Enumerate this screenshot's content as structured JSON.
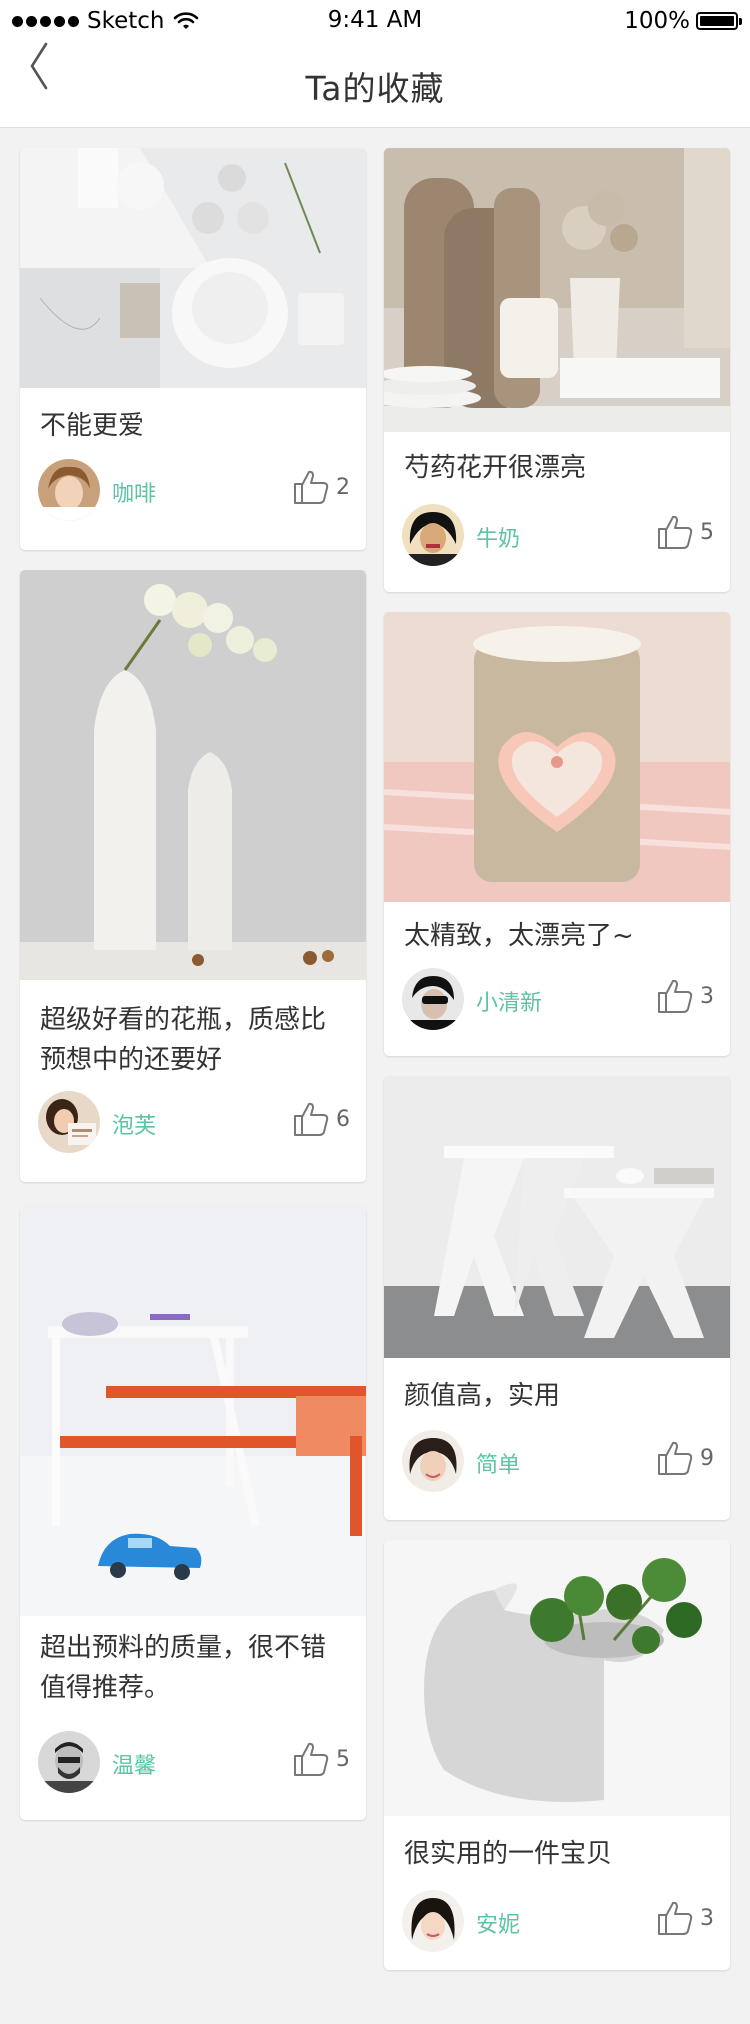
{
  "status_bar": {
    "carrier": "Sketch",
    "time": "9:41 AM",
    "battery": "100%"
  },
  "nav": {
    "title": "Ta的收藏",
    "back_icon": "chevron-left-icon"
  },
  "colors": {
    "username": "#5cc3a4",
    "background": "#f2f2f2",
    "card": "#ffffff"
  },
  "cards": [
    {
      "text": "不能更爱",
      "user": "咖啡",
      "likes": "2"
    },
    {
      "text": "超级好看的花瓶，质感比预想中的还要好",
      "user": "泡芙",
      "likes": "6"
    },
    {
      "text": "超出预料的质量，很不错值得推荐。",
      "user": "温馨",
      "likes": "5"
    },
    {
      "text": "芍药花开很漂亮",
      "user": "牛奶",
      "likes": "5"
    },
    {
      "text": "太精致，太漂亮了~",
      "user": "小清新",
      "likes": "3"
    },
    {
      "text": "颜值高，实用",
      "user": "简单",
      "likes": "9"
    },
    {
      "text": "很实用的一件宝贝",
      "user": "安妮",
      "likes": "3"
    }
  ]
}
